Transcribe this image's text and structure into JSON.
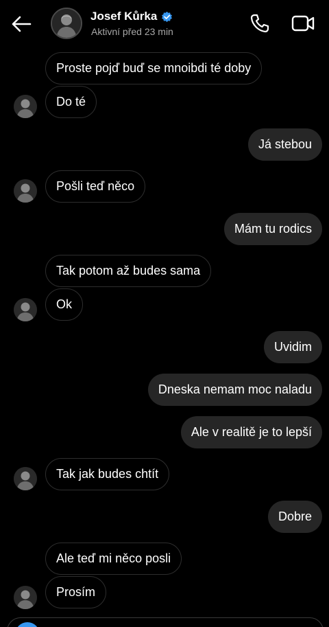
{
  "header": {
    "name": "Josef Kůrka",
    "status": "Aktivní před 23 min"
  },
  "colors": {
    "background": "#000000",
    "incoming_border": "#2e2e2e",
    "outgoing_bubble": "#262626",
    "verified": "#3797f0",
    "secondary_text": "#a8a8a8"
  },
  "icons": {
    "back": "arrow-left-icon",
    "verified": "verified-badge-icon",
    "call": "phone-icon",
    "video": "video-camera-icon"
  },
  "messages": [
    {
      "text": "Proste pojď buď se mnoibdi té doby",
      "side": "in",
      "avatar": false
    },
    {
      "text": "Do té",
      "side": "in",
      "avatar": true
    },
    {
      "text": "Já stebou",
      "side": "out"
    },
    {
      "text": "Pošli teď něco",
      "side": "in",
      "avatar": true
    },
    {
      "text": "Mám tu rodics",
      "side": "out"
    },
    {
      "text": "Tak potom až budes sama",
      "side": "in",
      "avatar": false
    },
    {
      "text": "Ok",
      "side": "in",
      "avatar": true
    },
    {
      "text": "Uvidim",
      "side": "out"
    },
    {
      "text": "Dneska nemam moc naladu",
      "side": "out"
    },
    {
      "text": "Ale v realitě je to lepší",
      "side": "out"
    },
    {
      "text": "Tak jak budes chtít",
      "side": "in",
      "avatar": true
    },
    {
      "text": "Dobre",
      "side": "out"
    },
    {
      "text": "Ale teď mi něco posli",
      "side": "in",
      "avatar": false
    },
    {
      "text": "Prosím",
      "side": "in",
      "avatar": true
    }
  ]
}
